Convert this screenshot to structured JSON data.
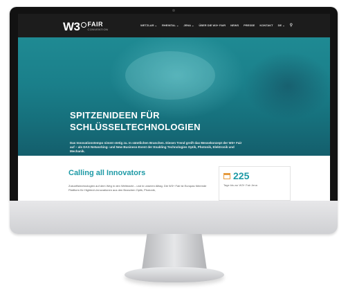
{
  "navbar": {
    "logo_main": "W3",
    "logo_fair": "FAIR",
    "logo_sub": "CONVENTION",
    "menu_items": [
      "WETZLAR ⌄",
      "RHEINTAL ⌄",
      "JENA ⌄",
      "ÜBER DIE W3+ FAIR",
      "NEWS",
      "PRESSE",
      "KONTAKT",
      "DE ⌄"
    ],
    "search_icon": "search-icon"
  },
  "hero": {
    "title_line1": "SPITZENIDEEN FÜR",
    "title_line2": "SCHLÜSSELTECHNOLOGIEN",
    "text": "Das Innovationstempo nimmt stetig zu. In sämtlichen Branchen. Diesen Trend greift das Messekonzept der W3+ Fair auf – als DAS Networking- und New Business-Event der Enabling Technologies Optik, Photonik, Elektronik und Mechanik."
  },
  "content": {
    "heading": "Calling all Innovators",
    "text": "Zukunftstechnologien auf dem Weg in den Weltmarkt – und in unseren Alltag. Die W3+ Fair ist Europas führende Plattform für Hightech-Innovationen aus den Branchen Optik, Photonik,",
    "counter_number": "225",
    "counter_label": "Tage bis zur W3+ Fair Jena",
    "counter_icon": "calendar-icon"
  },
  "colors": {
    "accent": "#1d9aa6",
    "nav_bg": "#1c1c1c",
    "hero_teal": "#1a7f8a",
    "calendar": "#e59a3e"
  }
}
